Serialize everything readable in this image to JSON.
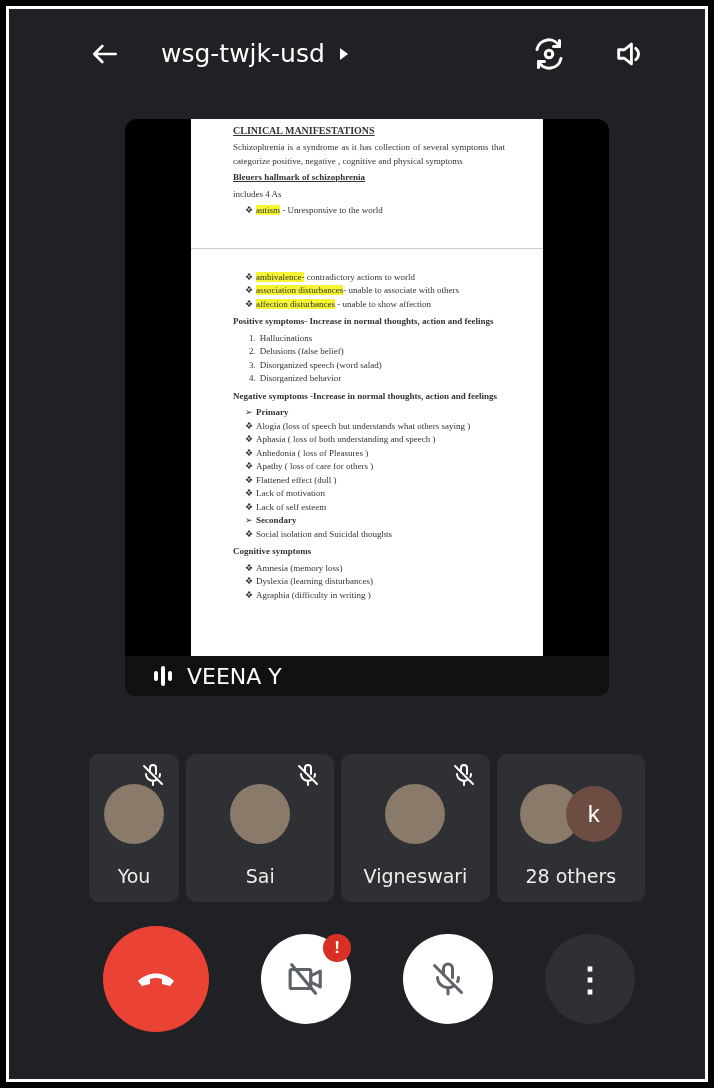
{
  "top_bar": {
    "meeting_code": "wsg-twjk-usd"
  },
  "presentation": {
    "presenter": "VEENA Y",
    "pages": [
      {
        "blocks": [
          {
            "kind": "title",
            "text": "CLINICAL MANIFESTATIONS"
          },
          {
            "kind": "paragraph",
            "text": "Schizophrenia is a syndrome as it has collection of several symptoms that categorize positive, negative , cognitive and physical symptoms"
          },
          {
            "kind": "subtitle",
            "text": "Bleuers hallmark of schizophrenia"
          },
          {
            "kind": "paragraph",
            "text": "includes 4 As"
          },
          {
            "kind": "bullet",
            "marker": "❖",
            "highlight": "autism",
            "text": " - Unresponsive to the world"
          }
        ]
      },
      {
        "blocks": [
          {
            "kind": "bullet",
            "marker": "❖",
            "highlight": "ambivalence-",
            "text": " contradictory actions to world"
          },
          {
            "kind": "bullet",
            "marker": "❖",
            "highlight": "association disturbances",
            "text": "- unable to associate with others"
          },
          {
            "kind": "bullet",
            "marker": "❖",
            "highlight": "affection disturbances",
            "text": " - unable to show affection"
          },
          {
            "kind": "heading",
            "text": "Positive symptoms- Increase in normal thoughts, action and feelings"
          },
          {
            "kind": "numbered",
            "marker": "1.",
            "text": "Hallucinations"
          },
          {
            "kind": "numbered",
            "marker": "2.",
            "text": "Delusions (false belief)"
          },
          {
            "kind": "numbered",
            "marker": "3.",
            "text": "Disorganized speech (word salad)"
          },
          {
            "kind": "numbered",
            "marker": "4.",
            "text": "Disorganized behavior"
          },
          {
            "kind": "heading",
            "text": "Negative symptoms -Increase in normal thoughts, action and feelings"
          },
          {
            "kind": "section",
            "marker": "➢",
            "text": "Primary"
          },
          {
            "kind": "bullet",
            "marker": "❖",
            "text": "Alogia (loss of speech but understands what others saying )"
          },
          {
            "kind": "bullet",
            "marker": "❖",
            "text": "Aphasia ( loss of both understanding and speech )"
          },
          {
            "kind": "bullet",
            "marker": "❖",
            "text": "Anhedonia ( loss of Pleasures )"
          },
          {
            "kind": "bullet",
            "marker": "❖",
            "text": "Apathy ( loss of care for others )"
          },
          {
            "kind": "bullet",
            "marker": "❖",
            "text": "Flattened effect (dull )"
          },
          {
            "kind": "bullet",
            "marker": "❖",
            "text": "Lack of motivation"
          },
          {
            "kind": "bullet",
            "marker": "❖",
            "text": "Lack of self esteem"
          },
          {
            "kind": "section",
            "marker": "➢",
            "text": "Secondary"
          },
          {
            "kind": "bullet",
            "marker": "❖",
            "text": "Social isolation and Suicidal thoughts"
          },
          {
            "kind": "heading",
            "text": "Cognitive symptoms"
          },
          {
            "kind": "bullet",
            "marker": "❖",
            "text": "Amnesia (memory loss)"
          },
          {
            "kind": "bullet",
            "marker": "❖",
            "text": "Dyslexia (learning disturbances)"
          },
          {
            "kind": "bullet",
            "marker": "❖",
            "text": "Agraphia (difficulty in writing )"
          }
        ]
      }
    ]
  },
  "participants": [
    {
      "kind": "person",
      "name": "You",
      "muted": true
    },
    {
      "kind": "person",
      "name": "Sai",
      "muted": true
    },
    {
      "kind": "person",
      "name": "Vigneswari",
      "muted": true
    },
    {
      "kind": "group",
      "name": "28 others",
      "initial": "k",
      "color": "#6d4c41"
    }
  ],
  "controls": [
    {
      "kind": "end-call"
    },
    {
      "kind": "camera",
      "on": false,
      "alert": "!"
    },
    {
      "kind": "mic",
      "on": false
    },
    {
      "kind": "more",
      "glyph": "⋮"
    }
  ]
}
